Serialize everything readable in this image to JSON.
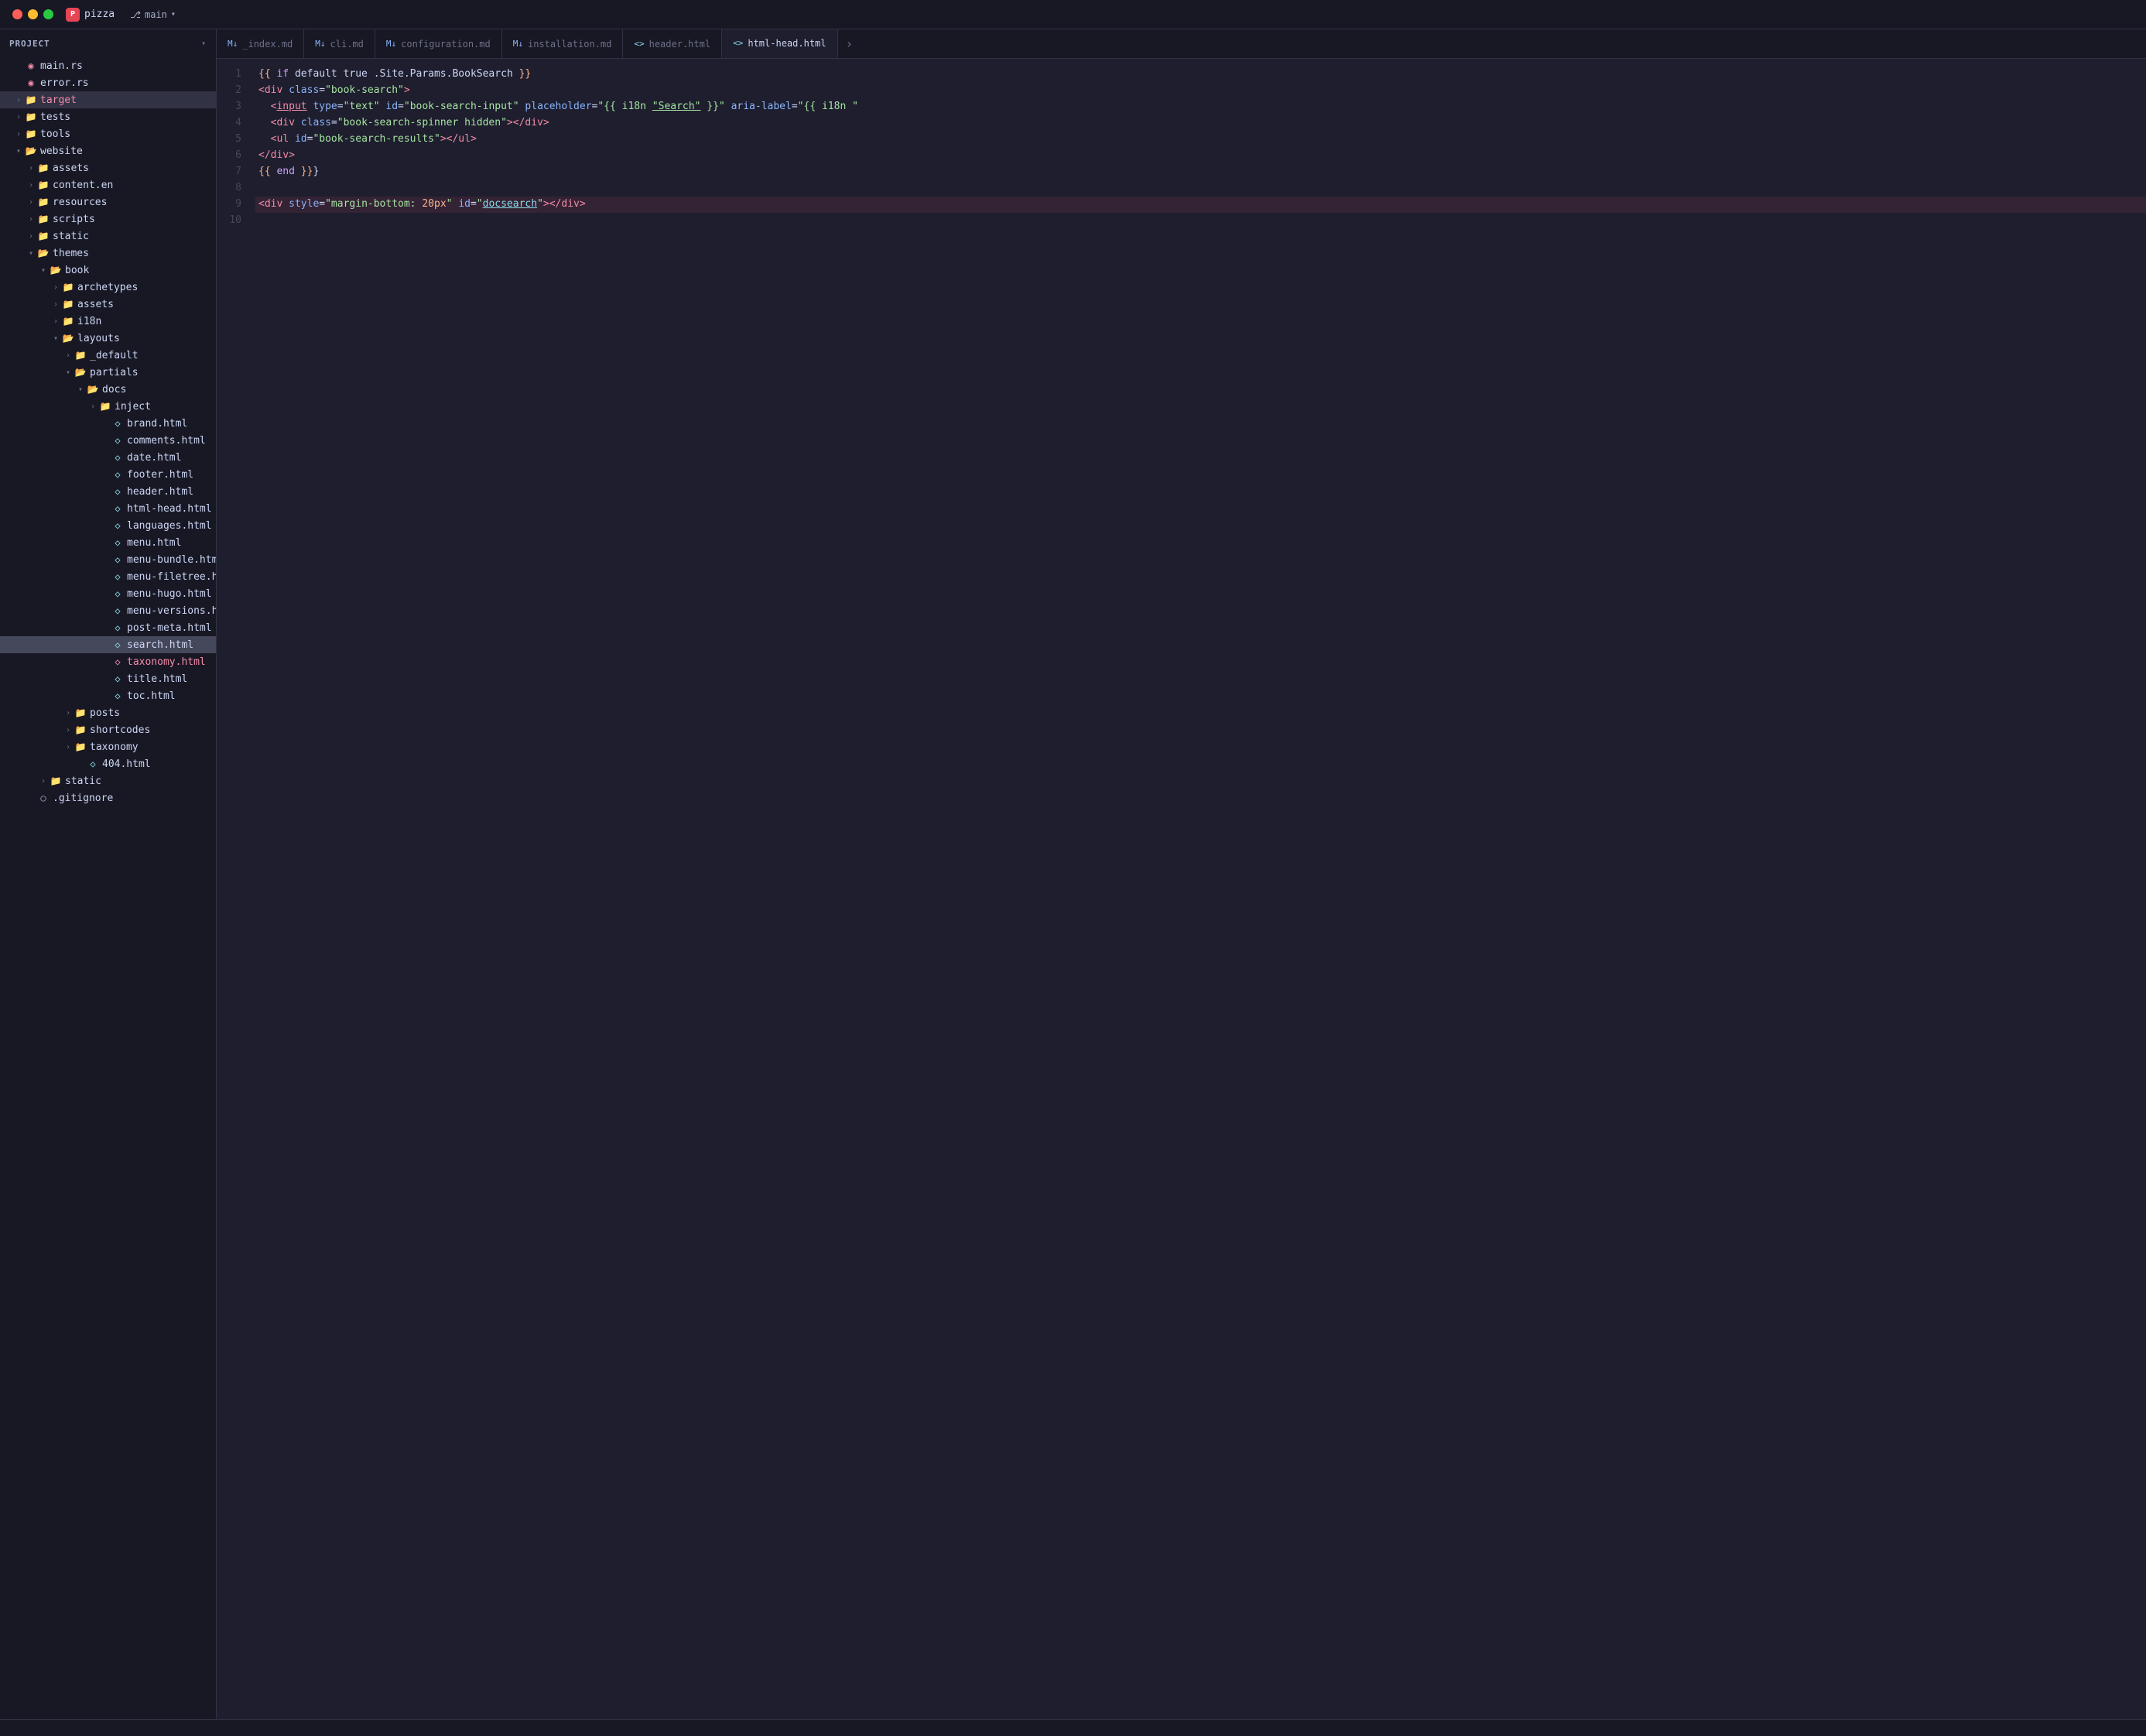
{
  "titlebar": {
    "app_name": "pizza",
    "branch_name": "main",
    "branch_icon": "⎇"
  },
  "sidebar": {
    "header": "Project",
    "files": [
      {
        "id": "main-rs",
        "label": "main.rs",
        "type": "file-rs",
        "indent": 1,
        "arrow": "empty"
      },
      {
        "id": "error-rs",
        "label": "error.rs",
        "type": "file-rs",
        "indent": 1,
        "arrow": "empty"
      },
      {
        "id": "target",
        "label": "target",
        "type": "folder",
        "indent": 1,
        "arrow": "closed",
        "special": "target"
      },
      {
        "id": "tests",
        "label": "tests",
        "type": "folder",
        "indent": 1,
        "arrow": "closed"
      },
      {
        "id": "tools",
        "label": "tools",
        "type": "folder",
        "indent": 1,
        "arrow": "closed"
      },
      {
        "id": "website",
        "label": "website",
        "type": "folder",
        "indent": 1,
        "arrow": "open"
      },
      {
        "id": "assets",
        "label": "assets",
        "type": "folder",
        "indent": 2,
        "arrow": "closed"
      },
      {
        "id": "content-en",
        "label": "content.en",
        "type": "folder",
        "indent": 2,
        "arrow": "closed"
      },
      {
        "id": "resources",
        "label": "resources",
        "type": "folder",
        "indent": 2,
        "arrow": "closed"
      },
      {
        "id": "scripts",
        "label": "scripts",
        "type": "folder",
        "indent": 2,
        "arrow": "closed"
      },
      {
        "id": "static",
        "label": "static",
        "type": "folder",
        "indent": 2,
        "arrow": "closed"
      },
      {
        "id": "themes",
        "label": "themes",
        "type": "folder",
        "indent": 2,
        "arrow": "open"
      },
      {
        "id": "book",
        "label": "book",
        "type": "folder",
        "indent": 3,
        "arrow": "open"
      },
      {
        "id": "archetypes",
        "label": "archetypes",
        "type": "folder",
        "indent": 4,
        "arrow": "closed"
      },
      {
        "id": "assets2",
        "label": "assets",
        "type": "folder",
        "indent": 4,
        "arrow": "closed"
      },
      {
        "id": "i18n",
        "label": "i18n",
        "type": "folder",
        "indent": 4,
        "arrow": "closed"
      },
      {
        "id": "layouts",
        "label": "layouts",
        "type": "folder",
        "indent": 4,
        "arrow": "open"
      },
      {
        "id": "_default",
        "label": "_default",
        "type": "folder",
        "indent": 5,
        "arrow": "closed"
      },
      {
        "id": "partials",
        "label": "partials",
        "type": "folder",
        "indent": 5,
        "arrow": "open"
      },
      {
        "id": "docs",
        "label": "docs",
        "type": "folder",
        "indent": 6,
        "arrow": "open"
      },
      {
        "id": "inject",
        "label": "inject",
        "type": "folder",
        "indent": 7,
        "arrow": "closed"
      },
      {
        "id": "brand-html",
        "label": "brand.html",
        "type": "file-html",
        "indent": 8,
        "arrow": "empty"
      },
      {
        "id": "comments-html",
        "label": "comments.html",
        "type": "file-html",
        "indent": 8,
        "arrow": "empty"
      },
      {
        "id": "date-html",
        "label": "date.html",
        "type": "file-html",
        "indent": 8,
        "arrow": "empty"
      },
      {
        "id": "footer-html",
        "label": "footer.html",
        "type": "file-html",
        "indent": 8,
        "arrow": "empty"
      },
      {
        "id": "header-html",
        "label": "header.html",
        "type": "file-html",
        "indent": 8,
        "arrow": "empty"
      },
      {
        "id": "html-head-html",
        "label": "html-head.html",
        "type": "file-html",
        "indent": 8,
        "arrow": "empty"
      },
      {
        "id": "languages-html",
        "label": "languages.html",
        "type": "file-html",
        "indent": 8,
        "arrow": "empty"
      },
      {
        "id": "menu-html",
        "label": "menu.html",
        "type": "file-html",
        "indent": 8,
        "arrow": "empty"
      },
      {
        "id": "menu-bundle-html",
        "label": "menu-bundle.html",
        "type": "file-html",
        "indent": 8,
        "arrow": "empty"
      },
      {
        "id": "menu-filetree-html",
        "label": "menu-filetree.html",
        "type": "file-html",
        "indent": 8,
        "arrow": "empty"
      },
      {
        "id": "menu-hugo-html",
        "label": "menu-hugo.html",
        "type": "file-html",
        "indent": 8,
        "arrow": "empty"
      },
      {
        "id": "menu-versions-html",
        "label": "menu-versions.html",
        "type": "file-html",
        "indent": 8,
        "arrow": "empty"
      },
      {
        "id": "post-meta-html",
        "label": "post-meta.html",
        "type": "file-html",
        "indent": 8,
        "arrow": "empty"
      },
      {
        "id": "search-html",
        "label": "search.html",
        "type": "file-html",
        "indent": 8,
        "arrow": "empty",
        "active": true
      },
      {
        "id": "taxonomy-html",
        "label": "taxonomy.html",
        "type": "file-html",
        "indent": 8,
        "arrow": "empty",
        "modified": true
      },
      {
        "id": "title-html",
        "label": "title.html",
        "type": "file-html",
        "indent": 8,
        "arrow": "empty"
      },
      {
        "id": "toc-html",
        "label": "toc.html",
        "type": "file-html",
        "indent": 8,
        "arrow": "empty"
      },
      {
        "id": "posts",
        "label": "posts",
        "type": "folder",
        "indent": 5,
        "arrow": "closed"
      },
      {
        "id": "shortcodes",
        "label": "shortcodes",
        "type": "folder",
        "indent": 5,
        "arrow": "closed"
      },
      {
        "id": "taxonomy",
        "label": "taxonomy",
        "type": "folder",
        "indent": 5,
        "arrow": "closed"
      },
      {
        "id": "404-html",
        "label": "404.html",
        "type": "file-html",
        "indent": 6,
        "arrow": "empty"
      },
      {
        "id": "static2",
        "label": "static",
        "type": "folder",
        "indent": 3,
        "arrow": "closed"
      },
      {
        "id": "gitignore",
        "label": ".gitignore",
        "type": "file-other",
        "indent": 2,
        "arrow": "empty"
      }
    ]
  },
  "tabs": [
    {
      "id": "index-md",
      "label": "_index.md",
      "type": "md",
      "active": false
    },
    {
      "id": "cli-md",
      "label": "cli.md",
      "type": "md",
      "active": false
    },
    {
      "id": "configuration-md",
      "label": "configuration.md",
      "type": "md",
      "active": false
    },
    {
      "id": "installation-md",
      "label": "installation.md",
      "type": "md",
      "active": false
    },
    {
      "id": "header-html-tab",
      "label": "header.html",
      "type": "html",
      "active": false
    },
    {
      "id": "html-head-html-tab",
      "label": "html-head.html",
      "type": "html",
      "active": false
    },
    {
      "id": "more",
      "label": "›",
      "type": "more"
    }
  ],
  "editor": {
    "filename": "search.html",
    "lines": [
      {
        "num": 1,
        "content": "{{ if default true .Site.Params.BookSearch }}"
      },
      {
        "num": 2,
        "content": "<div class=\"book-search\">"
      },
      {
        "num": 3,
        "content": "  <input type=\"text\" id=\"book-search-input\" placeholder=\"{{ i18n \\\"Search\\\" }}\" aria-label=\"{{ i18n \""
      },
      {
        "num": 4,
        "content": "  <div class=\"book-search-spinner hidden\"></div>"
      },
      {
        "num": 5,
        "content": "  <ul id=\"book-search-results\"></ul>"
      },
      {
        "num": 6,
        "content": "</div>"
      },
      {
        "num": 7,
        "content": "{{ end }}"
      },
      {
        "num": 8,
        "content": ""
      },
      {
        "num": 9,
        "content": "<div style=\"margin-bottom: 20px\" id=\"docsearch\"></div>"
      },
      {
        "num": 10,
        "content": ""
      }
    ]
  },
  "colors": {
    "accent": "#f38ba8",
    "branch": "#a6adc8",
    "folder": "#f9e2af",
    "file_rs": "#f38ba8",
    "file_html": "#89dceb",
    "file_md": "#89b4fa"
  }
}
